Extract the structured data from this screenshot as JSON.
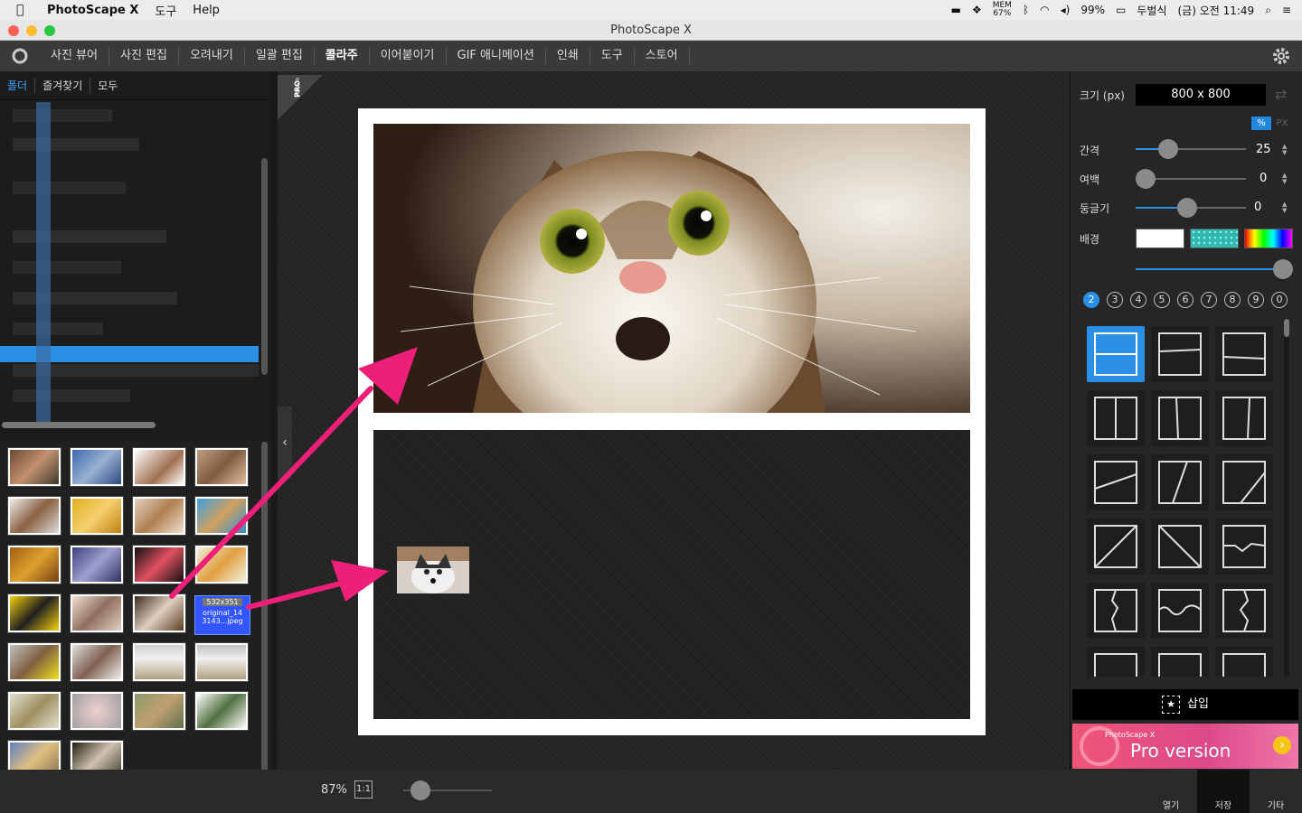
{
  "menubar": {
    "app_name": "PhotoScape X",
    "items": [
      "도구",
      "Help"
    ],
    "mem_label": "MEM",
    "mem_value": "67%",
    "battery": "99%",
    "user": "두벌식",
    "clock": "(금) 오전 11:49"
  },
  "window": {
    "title": "PhotoScape X"
  },
  "tabs": [
    {
      "label": "사진 뷰어"
    },
    {
      "label": "사진 편집"
    },
    {
      "label": "오려내기"
    },
    {
      "label": "일괄 편집"
    },
    {
      "label": "콜라주",
      "active": true
    },
    {
      "label": "이어붙이기"
    },
    {
      "label": "GIF 애니메이션"
    },
    {
      "label": "인쇄"
    },
    {
      "label": "도구"
    },
    {
      "label": "스토어"
    }
  ],
  "left_panel": {
    "folder_tabs": [
      "폴더",
      "즐겨찾기",
      "모두"
    ],
    "selected_thumb": {
      "size": "532x351",
      "name": "original_14 3143...jpeg"
    }
  },
  "canvas": {
    "pro_badge": "PRO",
    "pro_badge_sub": "Version"
  },
  "bottom": {
    "zoom": "87%",
    "actual_size": "1:1",
    "open_label": "열기",
    "save_label": "저장",
    "more_label": "기타"
  },
  "right_panel": {
    "size_label": "크기 (px)",
    "size_value": "800 x 800",
    "unit_percent": "%",
    "unit_px": "PX",
    "spacing_label": "간격",
    "spacing_value": "25",
    "spacing_level": 0.25,
    "margin_label": "여백",
    "margin_value": "0",
    "rounded_label": "둥글기",
    "rounded_value": "0",
    "bg_label": "배경",
    "counts": [
      "2",
      "3",
      "4",
      "5",
      "6",
      "7",
      "8",
      "9",
      "0"
    ],
    "insert_label": "삽입",
    "banner_small": "PhotoScape X",
    "banner_big": "Pro version"
  },
  "colors": {
    "accent": "#2a8fe6",
    "arrow": "#ee1f78"
  }
}
